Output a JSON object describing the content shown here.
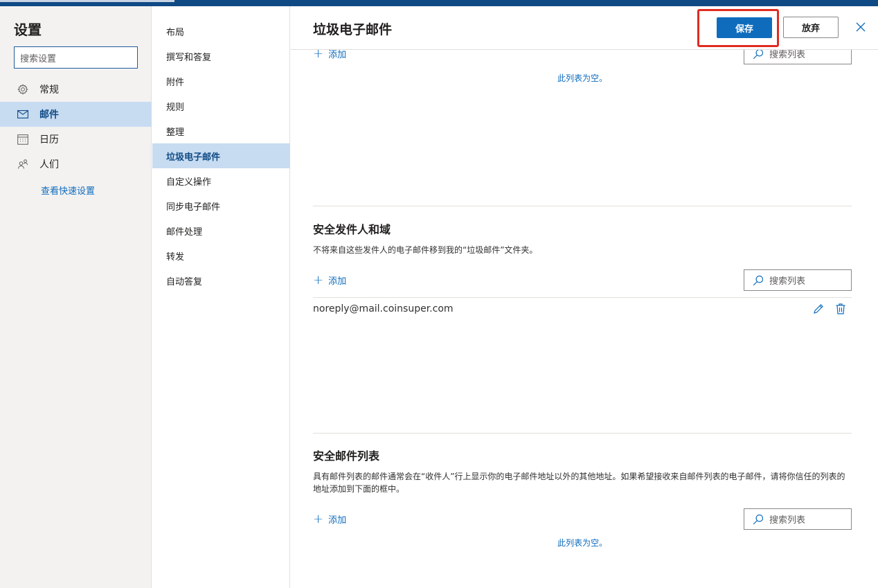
{
  "settings": {
    "title": "设置",
    "search_placeholder": "搜索设置"
  },
  "nav": {
    "items": [
      {
        "label": "常规",
        "icon": "gear-icon"
      },
      {
        "label": "邮件",
        "icon": "mail-icon",
        "active": true
      },
      {
        "label": "日历",
        "icon": "calendar-icon"
      },
      {
        "label": "人们",
        "icon": "people-icon"
      }
    ],
    "quick_settings": "查看快速设置"
  },
  "mail_menu": {
    "items": [
      "布局",
      "撰写和答复",
      "附件",
      "规则",
      "整理",
      "垃圾电子邮件",
      "自定义操作",
      "同步电子邮件",
      "邮件处理",
      "转发",
      "自动答复"
    ],
    "active_index": 5
  },
  "page": {
    "title": "垃圾电子邮件",
    "save_label": "保存",
    "discard_label": "放弃"
  },
  "blocked": {
    "add_label": "添加",
    "search_label": "搜索列表",
    "empty_text": "此列表为空。"
  },
  "safe_senders": {
    "title": "安全发件人和域",
    "description": "不将来自这些发件人的电子邮件移到我的“垃圾邮件”文件夹。",
    "add_label": "添加",
    "search_label": "搜索列表",
    "entries": [
      "noreply@mail.coinsuper.com"
    ]
  },
  "safe_lists": {
    "title": "安全邮件列表",
    "description": "具有邮件列表的邮件通常会在“收件人”行上显示你的电子邮件地址以外的其他地址。如果希望接收来自邮件列表的电子邮件，请将你信任的列表的地址添加到下面的框中。",
    "add_label": "添加",
    "search_label": "搜索列表",
    "empty_text": "此列表为空。"
  },
  "colors": {
    "accent": "#0f6cbd",
    "active_bg": "#c7dcf1",
    "highlight": "#e02b20"
  }
}
